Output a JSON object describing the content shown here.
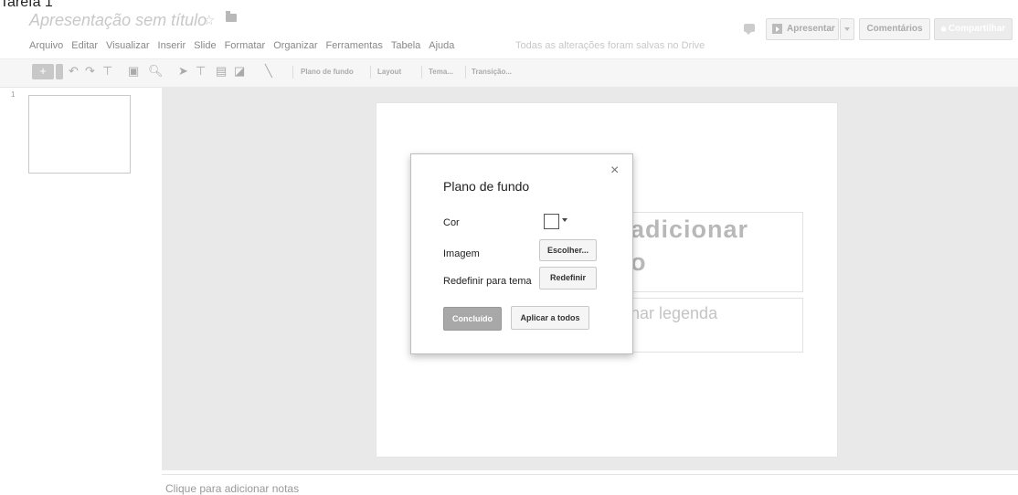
{
  "top_clipped_text": "Tarefa 1",
  "doc": {
    "title": "Apresentação sem título",
    "star_icon": "star-icon",
    "folder_icon": "folder-icon"
  },
  "menu": [
    "Arquivo",
    "Editar",
    "Visualizar",
    "Inserir",
    "Slide",
    "Formatar",
    "Organizar",
    "Ferramentas",
    "Tabela",
    "Ajuda"
  ],
  "save_status": "Todas as alterações foram salvas no Drive",
  "header_buttons": {
    "present": "Apresentar",
    "comments": "Comentários",
    "share": "Compartilhar"
  },
  "toolbar": {
    "background": "Plano de fundo",
    "layout": "Layout",
    "theme": "Tema...",
    "transition": "Transição..."
  },
  "slides": {
    "slide_number": "1"
  },
  "slide": {
    "title_placeholder_line1": "adicionar",
    "title_placeholder_line2": "o",
    "subtitle_placeholder": "nar legenda"
  },
  "notes_placeholder": "Clique para adicionar notas",
  "dialog": {
    "title": "Plano de fundo",
    "close": "×",
    "color_label": "Cor",
    "image_label": "Imagem",
    "choose_button": "Escolher...",
    "reset_label": "Redefinir para tema",
    "reset_button": "Redefinir",
    "done_button": "Concluído",
    "apply_all_button": "Aplicar a todos"
  }
}
